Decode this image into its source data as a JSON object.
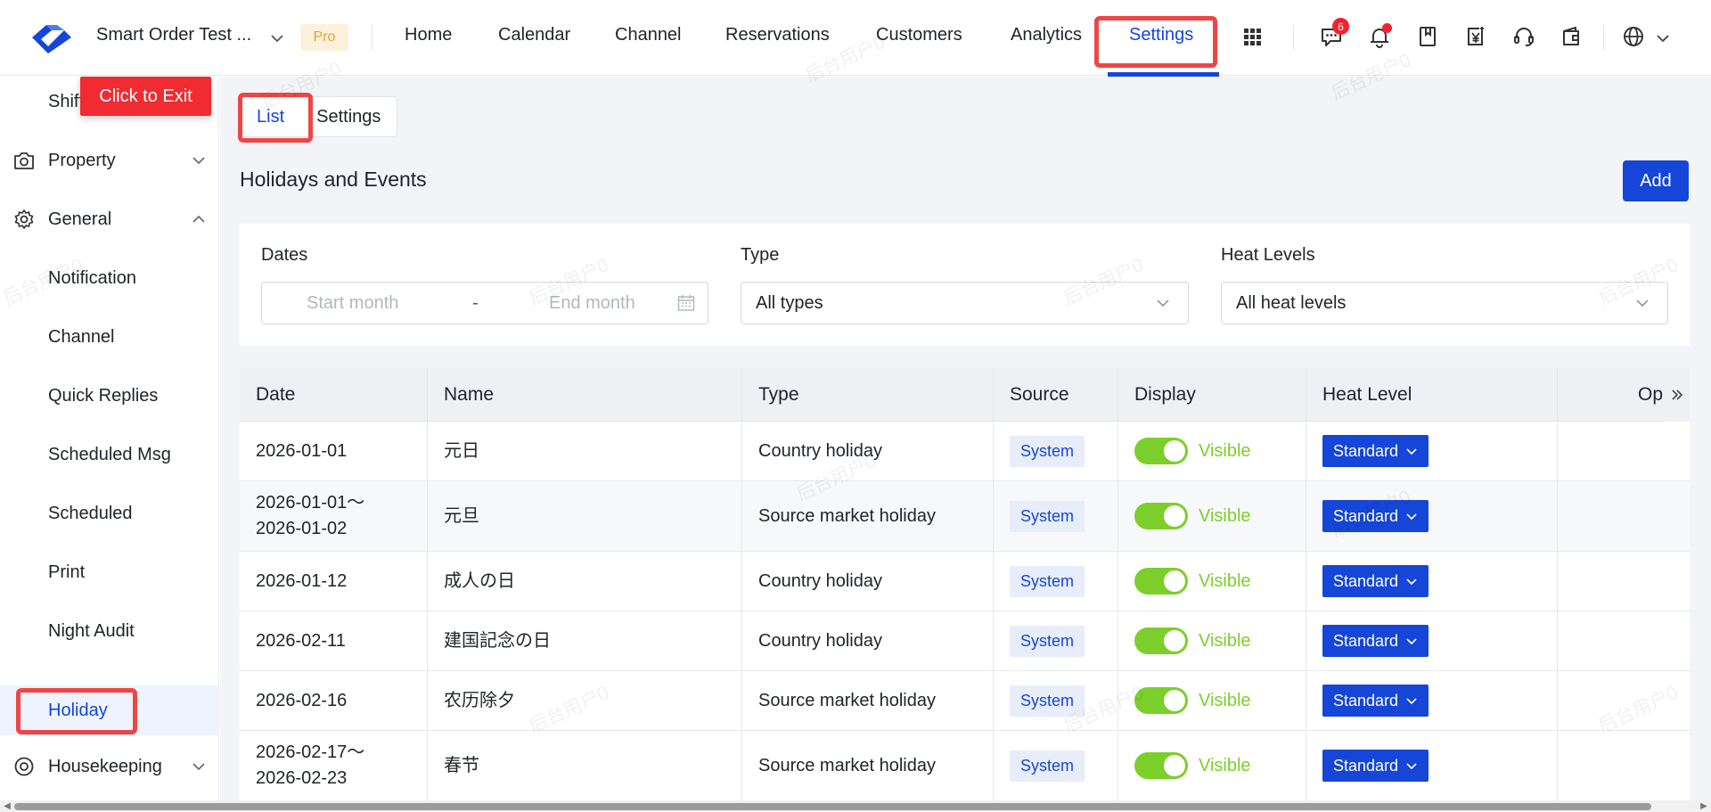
{
  "header": {
    "store_name": "Smart Order Test ...",
    "plan_badge": "Pro",
    "nav": [
      {
        "label": "Home"
      },
      {
        "label": "Calendar"
      },
      {
        "label": "Channel"
      },
      {
        "label": "Reservations"
      },
      {
        "label": "Customers"
      },
      {
        "label": "Analytics"
      },
      {
        "label": "Settings",
        "active": true
      }
    ],
    "message_count": "6",
    "icons": [
      "apps-grid-icon",
      "message-icon",
      "bell-icon",
      "bookmark-icon",
      "invoice-yen-icon",
      "headset-icon",
      "wallet-icon",
      "globe-icon"
    ]
  },
  "sidebar": {
    "exit_button": "Click to Exit",
    "items": [
      {
        "label": "Shift"
      },
      {
        "label": "Property",
        "icon": "camera-icon",
        "expandable": true
      },
      {
        "label": "General",
        "icon": "gear-icon",
        "expanded": true
      },
      {
        "label": "Notification"
      },
      {
        "label": "Channel"
      },
      {
        "label": "Quick Replies"
      },
      {
        "label": "Scheduled Msg"
      },
      {
        "label": "Scheduled"
      },
      {
        "label": "Print"
      },
      {
        "label": "Night Audit"
      },
      {
        "label": "Holiday",
        "active": true
      },
      {
        "label": "Housekeeping",
        "icon": "target-icon",
        "expandable": true
      }
    ]
  },
  "tabs": {
    "list": "List",
    "settings": "Settings"
  },
  "page": {
    "title": "Holidays and Events",
    "add_label": "Add"
  },
  "filters": {
    "dates_label": "Dates",
    "start_placeholder": "Start month",
    "separator": "-",
    "end_placeholder": "End month",
    "type_label": "Type",
    "type_value": "All types",
    "heat_label": "Heat Levels",
    "heat_value": "All heat levels"
  },
  "table": {
    "columns": [
      "Date",
      "Name",
      "Type",
      "Source",
      "Display",
      "Heat Level",
      "Op"
    ],
    "rows": [
      {
        "date": "2026-01-01",
        "name": "元日",
        "type": "Country holiday",
        "source": "System",
        "display": "Visible",
        "heat": "Standard"
      },
      {
        "date": "2026-01-01～",
        "date2": "2026-01-02",
        "name": "元旦",
        "type": "Source market holiday",
        "source": "System",
        "display": "Visible",
        "heat": "Standard"
      },
      {
        "date": "2026-01-12",
        "name": "成人の日",
        "type": "Country holiday",
        "source": "System",
        "display": "Visible",
        "heat": "Standard"
      },
      {
        "date": "2026-02-11",
        "name": "建国記念の日",
        "type": "Country holiday",
        "source": "System",
        "display": "Visible",
        "heat": "Standard"
      },
      {
        "date": "2026-02-16",
        "name": "农历除夕",
        "type": "Source market holiday",
        "source": "System",
        "display": "Visible",
        "heat": "Standard"
      },
      {
        "date": "2026-02-17～",
        "date2": "2026-02-23",
        "name": "春节",
        "type": "Source market holiday",
        "source": "System",
        "display": "Visible",
        "heat": "Standard"
      }
    ]
  },
  "watermark": "后台用户0",
  "colors": {
    "primary": "#1546d8",
    "highlight": "#f04545",
    "toggle_on": "#7ccf2a",
    "exit": "#f02b32"
  }
}
